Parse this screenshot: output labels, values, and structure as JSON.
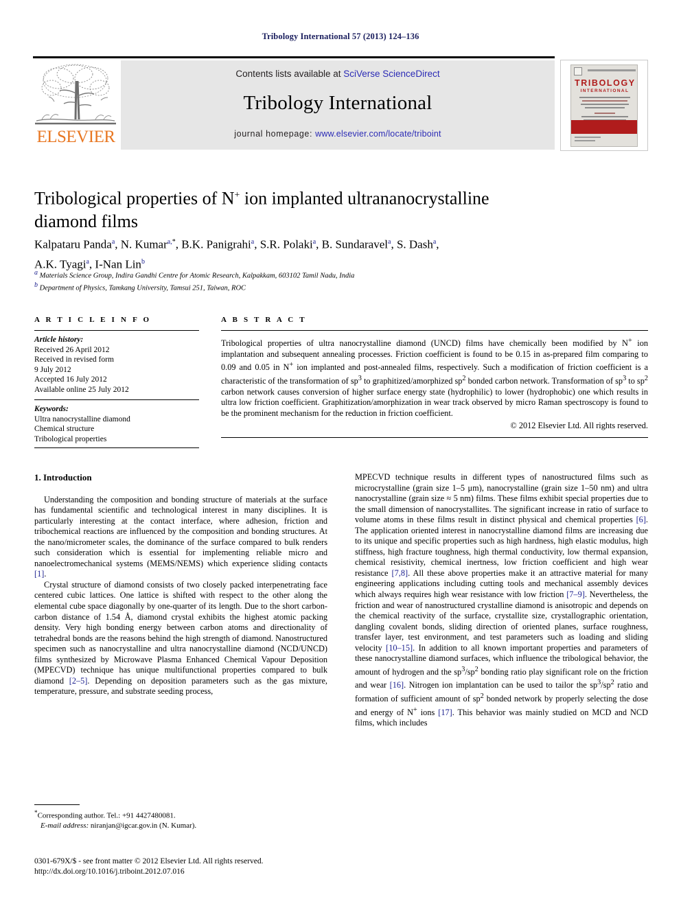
{
  "running_head": "Tribology International 57 (2013) 124–136",
  "masthead": {
    "contents_prefix": "Contents lists available at ",
    "contents_link": "SciVerse ScienceDirect",
    "journal_name": "Tribology International",
    "homepage_prefix": "journal homepage: ",
    "homepage_link": "www.elsevier.com/locate/triboint",
    "publisher": "ELSEVIER",
    "cover": {
      "title_line1": "TRIBOLOGY",
      "title_line2": "INTERNATIONAL"
    },
    "link_color": "#2b2bb5",
    "band_color": "#e6e6e6",
    "elsevier_orange": "#e87722",
    "cover_red": "#b01c1c"
  },
  "article": {
    "title_line1": "Tribological properties of N",
    "title_sup": "+",
    "title_line1b": " ion implanted ultrananocrystalline",
    "title_line2": "diamond films",
    "authors": [
      {
        "name": "Kalpataru Panda",
        "sup": "a",
        "sep": ", "
      },
      {
        "name": "N. Kumar",
        "sup": "a,",
        "star": "*",
        "sep": ", "
      },
      {
        "name": "B.K. Panigrahi",
        "sup": "a",
        "sep": ", "
      },
      {
        "name": "S.R. Polaki",
        "sup": "a",
        "sep": ", "
      },
      {
        "name": "B. Sundaravel",
        "sup": "a",
        "sep": ", "
      },
      {
        "name": "S. Dash",
        "sup": "a",
        "sep": ", "
      },
      {
        "name": "A.K. Tyagi",
        "sup": "a",
        "sep": ", "
      },
      {
        "name": "I-Nan Lin",
        "sup": "b",
        "sep": ""
      }
    ],
    "affiliations": [
      {
        "sup": "a",
        "text": "Materials Science Group, Indira Gandhi Centre for Atomic Research, Kalpakkam, 603102 Tamil Nadu, India"
      },
      {
        "sup": "b",
        "text": "Department of Physics, Tamkang University, Tamsui 251, Taiwan, ROC"
      }
    ]
  },
  "article_info": {
    "heading": "A R T I C L E  I N F O",
    "history_label": "Article history:",
    "history": [
      "Received 26 April 2012",
      "Received in revised form",
      "9 July 2012",
      "Accepted 16 July 2012",
      "Available online 25 July 2012"
    ],
    "keywords_label": "Keywords:",
    "keywords": [
      "Ultra nanocrystalline diamond",
      "Chemical structure",
      "Tribological properties"
    ]
  },
  "abstract": {
    "heading": "A B S T R A C T",
    "text_part1": "Tribological properties of ultra nanocrystalline diamond (UNCD) films have chemically been modified by N",
    "sup1": "+",
    "text_part2": " ion implantation and subsequent annealing processes. Friction coefficient is found to be 0.15 in as-prepared film comparing to 0.09 and 0.05 in N",
    "sup2": "+",
    "text_part3": " ion implanted and post-annealed films, respectively. Such a modification of friction coefficient is a characteristic of the transformation of sp",
    "sup3": "3",
    "text_part4": " to graphitized/amorphized sp",
    "sup4": "2",
    "text_part5": " bonded carbon network. Transformation of sp",
    "sup5": "3",
    "text_part6": " to sp",
    "sup6": "2",
    "text_part7": " carbon network causes conversion of higher surface energy state (hydrophilic) to lower (hydrophobic) one which results in ultra low friction coefficient. Graphitization/amorphization in wear track observed by micro Raman spectroscopy is found to be the prominent mechanism for the reduction in friction coefficient.",
    "copyright": "© 2012 Elsevier Ltd. All rights reserved."
  },
  "body": {
    "section_number_title": "1.  Introduction",
    "left_para1_a": "Understanding the composition and bonding structure of materials at the surface has fundamental scientific and technological interest in many disciplines. It is particularly interesting at the contact interface, where adhesion, friction and tribochemical reactions are influenced by the composition and bonding structures. At the nano/micrometer scales, the dominance of the surface compared to bulk renders such consideration which is essential for implementing reliable micro and nanoelectromechanical systems (MEMS/NEMS) which experience sliding contacts ",
    "left_para1_ref": "[1]",
    "left_para1_b": ".",
    "left_para2_a": "Crystal structure of diamond consists of two closely packed interpenetrating face centered cubic lattices. One lattice is shifted with respect to the other along the elemental cube space diagonally by one-quarter of its length. Due to the short carbon-carbon distance of 1.54 Å, diamond crystal exhibits the highest atomic packing density. Very high bonding energy between carbon atoms and directionality of tetrahedral bonds are the reasons behind the high strength of diamond. Nanostructured specimen such as nanocrystalline and ultra nanocrystalline diamond (NCD/UNCD) films synthesized by Microwave Plasma Enhanced Chemical Vapour Deposition (MPECVD) technique has unique multifunctional properties compared to bulk diamond ",
    "left_para2_ref": "[2–5]",
    "left_para2_b": ". Depending on deposition parameters such as the gas mixture, temperature, pressure, and substrate seeding process,",
    "right_para1_a": "MPECVD technique results in different types of nanostructured films such as microcrystalline (grain size 1–5 μm), nanocrystalline (grain size 1–50 nm) and ultra nanocrystalline (grain size ≈ 5 nm) films. These films exhibit special properties due to the small dimension of nanocrystallites. The significant increase in ratio of surface to volume atoms in these films result in distinct physical and chemical properties ",
    "right_para1_ref1": "[6]",
    "right_para1_b": ". The application oriented interest in nanocrystalline diamond films are increasing due to its unique and specific properties such as high hardness, high elastic modulus, high stiffness, high fracture toughness, high thermal conductivity, low thermal expansion, chemical resistivity, chemical inertness, low friction coefficient and high wear resistance ",
    "right_para1_ref2": "[7,8]",
    "right_para1_c": ". All these above properties make it an attractive material for many engineering applications including cutting tools and mechanical assembly devices which always requires high wear resistance with low friction ",
    "right_para1_ref3": "[7–9]",
    "right_para1_d": ". Nevertheless, the friction and wear of nanostructured crystalline diamond is anisotropic and depends on the chemical reactivity of the surface, crystallite size, crystallographic orientation, dangling covalent bonds, sliding direction of oriented planes, surface roughness, transfer layer, test environment, and test parameters such as loading and sliding velocity ",
    "right_para1_ref4": "[10–15]",
    "right_para1_e": ". In addition to all known important properties and parameters of these nanocrystalline diamond surfaces, which influence the tribological behavior, the amount of hydrogen and the sp",
    "sup_a": "3",
    "right_para1_f": "/sp",
    "sup_b": "2",
    "right_para1_g": " bonding ratio play significant role on the friction and wear ",
    "right_para1_ref5": "[16]",
    "right_para1_h": ". Nitrogen ion implantation can be used to tailor the sp",
    "sup_c": "3",
    "right_para1_i": "/sp",
    "sup_d": "2",
    "right_para1_j": " ratio and formation of sufficient amount of sp",
    "sup_e": "2",
    "right_para1_k": " bonded network by properly selecting the dose and energy of N",
    "sup_f": "+",
    "right_para1_l": " ions ",
    "right_para1_ref6": "[17]",
    "right_para1_m": ". This behavior was mainly studied on MCD and NCD films, which includes"
  },
  "footnote": {
    "marker": "*",
    "line1": "Corresponding author. Tel.: +91 4427480081.",
    "email_label": "E-mail address:",
    "email": " niranjan@igcar.gov.in (N. Kumar)."
  },
  "imprint": {
    "line1": "0301-679X/$ - see front matter © 2012 Elsevier Ltd. All rights reserved.",
    "line2": "http://dx.doi.org/10.1016/j.triboint.2012.07.016"
  }
}
